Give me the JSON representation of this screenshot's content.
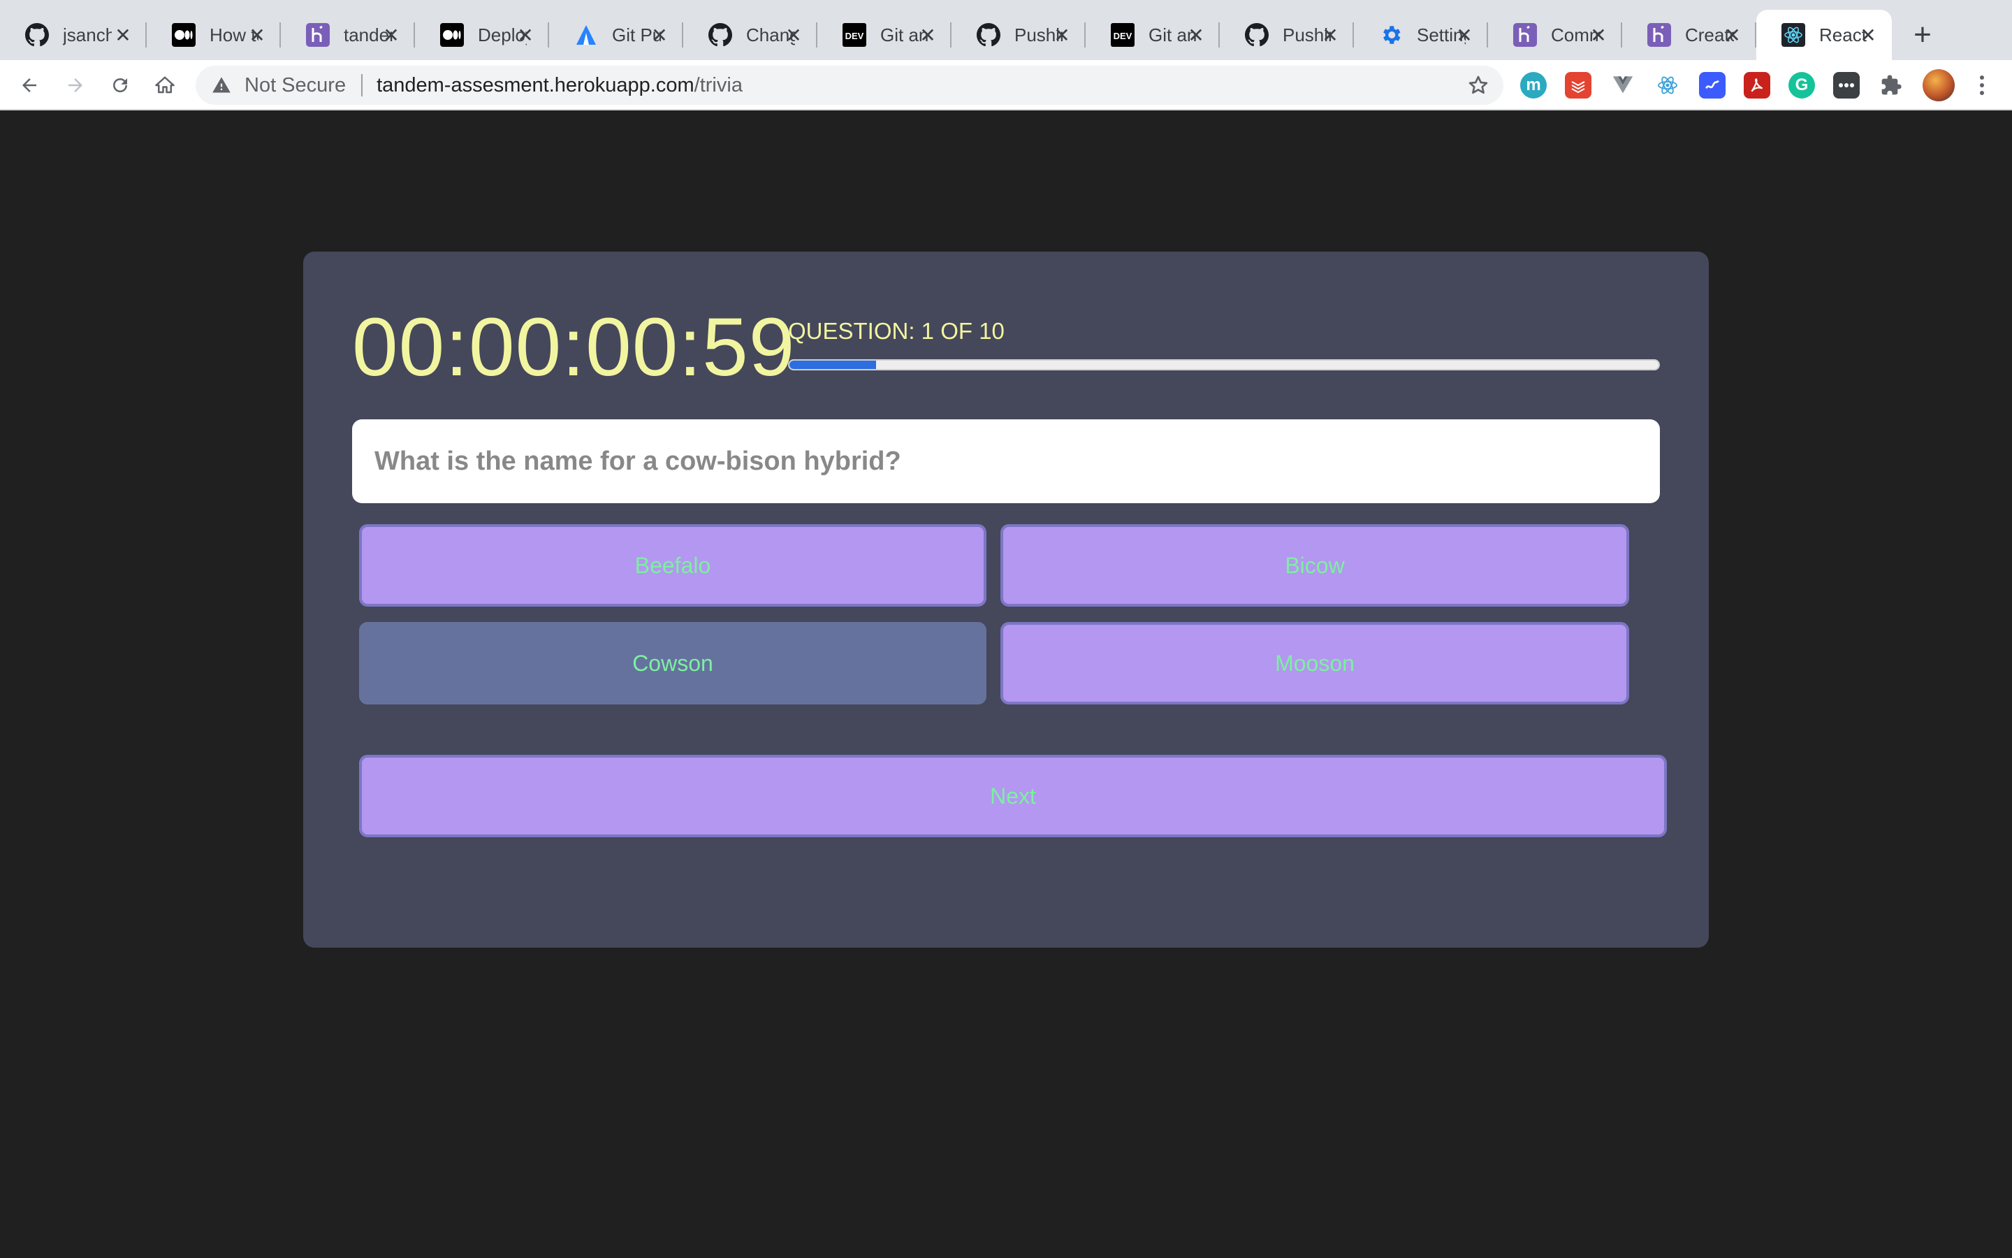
{
  "browser": {
    "tabs": [
      {
        "title": "jsanchez",
        "icon": "github-icon"
      },
      {
        "title": "How to",
        "icon": "medium-icon"
      },
      {
        "title": "tandem",
        "icon": "heroku-icon"
      },
      {
        "title": "Deploy",
        "icon": "medium-icon"
      },
      {
        "title": "Git Push",
        "icon": "atlassian-icon"
      },
      {
        "title": "Change",
        "icon": "github-icon"
      },
      {
        "title": "Git and",
        "icon": "dev-icon"
      },
      {
        "title": "Pushing",
        "icon": "github-icon"
      },
      {
        "title": "Git and",
        "icon": "dev-icon"
      },
      {
        "title": "Pushing",
        "icon": "github-icon"
      },
      {
        "title": "Settings",
        "icon": "gear-icon"
      },
      {
        "title": "Comm",
        "icon": "heroku-icon"
      },
      {
        "title": "Create",
        "icon": "heroku-icon"
      },
      {
        "title": "React",
        "icon": "react-icon",
        "active": true
      }
    ],
    "new_tab_label": "+",
    "security_label": "Not Secure",
    "url_host": "tandem-assesment.herokuapp.com",
    "url_path": "/trivia",
    "extensions": [
      {
        "name": "m",
        "color": "#2aa9c0"
      },
      {
        "name": "todoist",
        "color": "#e44332"
      },
      {
        "name": "vue",
        "color": "#8d959c"
      },
      {
        "name": "react-devtools",
        "color": "#61dafb"
      },
      {
        "name": "pipe",
        "color": "#3b5bfd"
      },
      {
        "name": "acrobat",
        "color": "#c9221c"
      },
      {
        "name": "grammarly",
        "color": "#15c39a"
      },
      {
        "name": "more",
        "color": "#3c4043"
      },
      {
        "name": "puzzle",
        "color": "#5f6368"
      }
    ]
  },
  "trivia": {
    "timer": "00:00:00:59",
    "question_counter": "QUESTION: 1 OF 10",
    "progress_fraction": 0.1,
    "question": "What is the name for a cow-bison hybrid?",
    "answers": [
      "Beefalo",
      "Bicow",
      "Cowson",
      "Mooson"
    ],
    "selected_answer": "Cowson",
    "next_label": "Next"
  },
  "colors": {
    "page_background": "#202020",
    "card_background": "#45475a",
    "timer_text": "#f2f5a0",
    "answer_button": "#b397f0",
    "answer_text": "#7cf0a0",
    "selected_answer": "#66729e",
    "progress_fill": "#2d6ee0"
  }
}
